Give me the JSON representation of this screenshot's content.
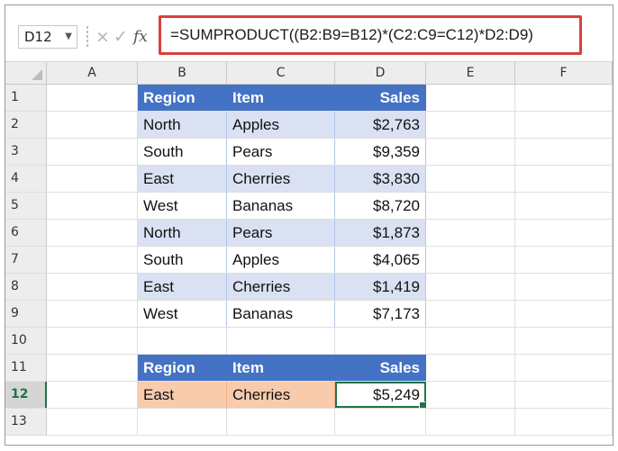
{
  "formula_bar": {
    "name_box": "D12",
    "cancel_icon": "×",
    "enter_icon": "✓",
    "fx_label": "fx",
    "formula": "=SUMPRODUCT((B2:B9=B12)*(C2:C9=C12)*D2:D9)"
  },
  "columns": [
    "A",
    "B",
    "C",
    "D",
    "E",
    "F"
  ],
  "rows": [
    {
      "num": "1",
      "b": "Region",
      "c": "Item",
      "d": "Sales"
    },
    {
      "num": "2",
      "b": "North",
      "c": "Apples",
      "d": "$2,763"
    },
    {
      "num": "3",
      "b": "South",
      "c": "Pears",
      "d": "$9,359"
    },
    {
      "num": "4",
      "b": "East",
      "c": "Cherries",
      "d": "$3,830"
    },
    {
      "num": "5",
      "b": "West",
      "c": "Bananas",
      "d": "$8,720"
    },
    {
      "num": "6",
      "b": "North",
      "c": "Pears",
      "d": "$1,873"
    },
    {
      "num": "7",
      "b": "South",
      "c": "Apples",
      "d": "$4,065"
    },
    {
      "num": "8",
      "b": "East",
      "c": "Cherries",
      "d": "$1,419"
    },
    {
      "num": "9",
      "b": "West",
      "c": "Bananas",
      "d": "$7,173"
    },
    {
      "num": "10",
      "b": "",
      "c": "",
      "d": ""
    },
    {
      "num": "11",
      "b": "Region",
      "c": "Item",
      "d": "Sales"
    },
    {
      "num": "12",
      "b": "East",
      "c": "Cherries",
      "d": "$5,249"
    },
    {
      "num": "13",
      "b": "",
      "c": "",
      "d": ""
    }
  ],
  "colors": {
    "header_fill": "#4472c4",
    "band_fill": "#d9e1f2",
    "criteria_fill": "#f8cbad",
    "formula_highlight": "#d9403c",
    "selection": "#217346"
  }
}
